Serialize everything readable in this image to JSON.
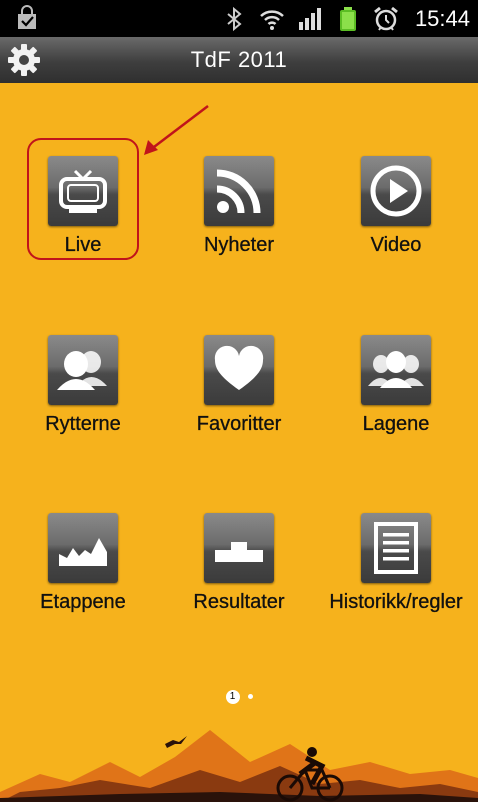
{
  "status_bar": {
    "time": "15:44",
    "icons": [
      "shopping-bag-icon",
      "bluetooth-icon",
      "wifi-icon",
      "signal-icon",
      "battery-icon",
      "alarm-icon"
    ]
  },
  "app": {
    "title": "TdF 2011",
    "settings_icon": "gear-icon",
    "background_color": "#f6b21c",
    "highlight_color": "#c0141b"
  },
  "grid": [
    {
      "id": "live",
      "label": "Live",
      "icon": "tv-icon"
    },
    {
      "id": "nyheter",
      "label": "Nyheter",
      "icon": "rss-icon"
    },
    {
      "id": "video",
      "label": "Video",
      "icon": "play-icon"
    },
    {
      "id": "rytterne",
      "label": "Rytterne",
      "icon": "riders-icon"
    },
    {
      "id": "favoritter",
      "label": "Favoritter",
      "icon": "heart-icon"
    },
    {
      "id": "lagene",
      "label": "Lagene",
      "icon": "teams-icon"
    },
    {
      "id": "etappene",
      "label": "Etappene",
      "icon": "stage-profile-icon"
    },
    {
      "id": "resultater",
      "label": "Resultater",
      "icon": "podium-icon"
    },
    {
      "id": "historikk",
      "label": "Historikk/regler",
      "icon": "document-icon"
    }
  ],
  "pager": {
    "current_page": "1",
    "total_pages": 2
  }
}
